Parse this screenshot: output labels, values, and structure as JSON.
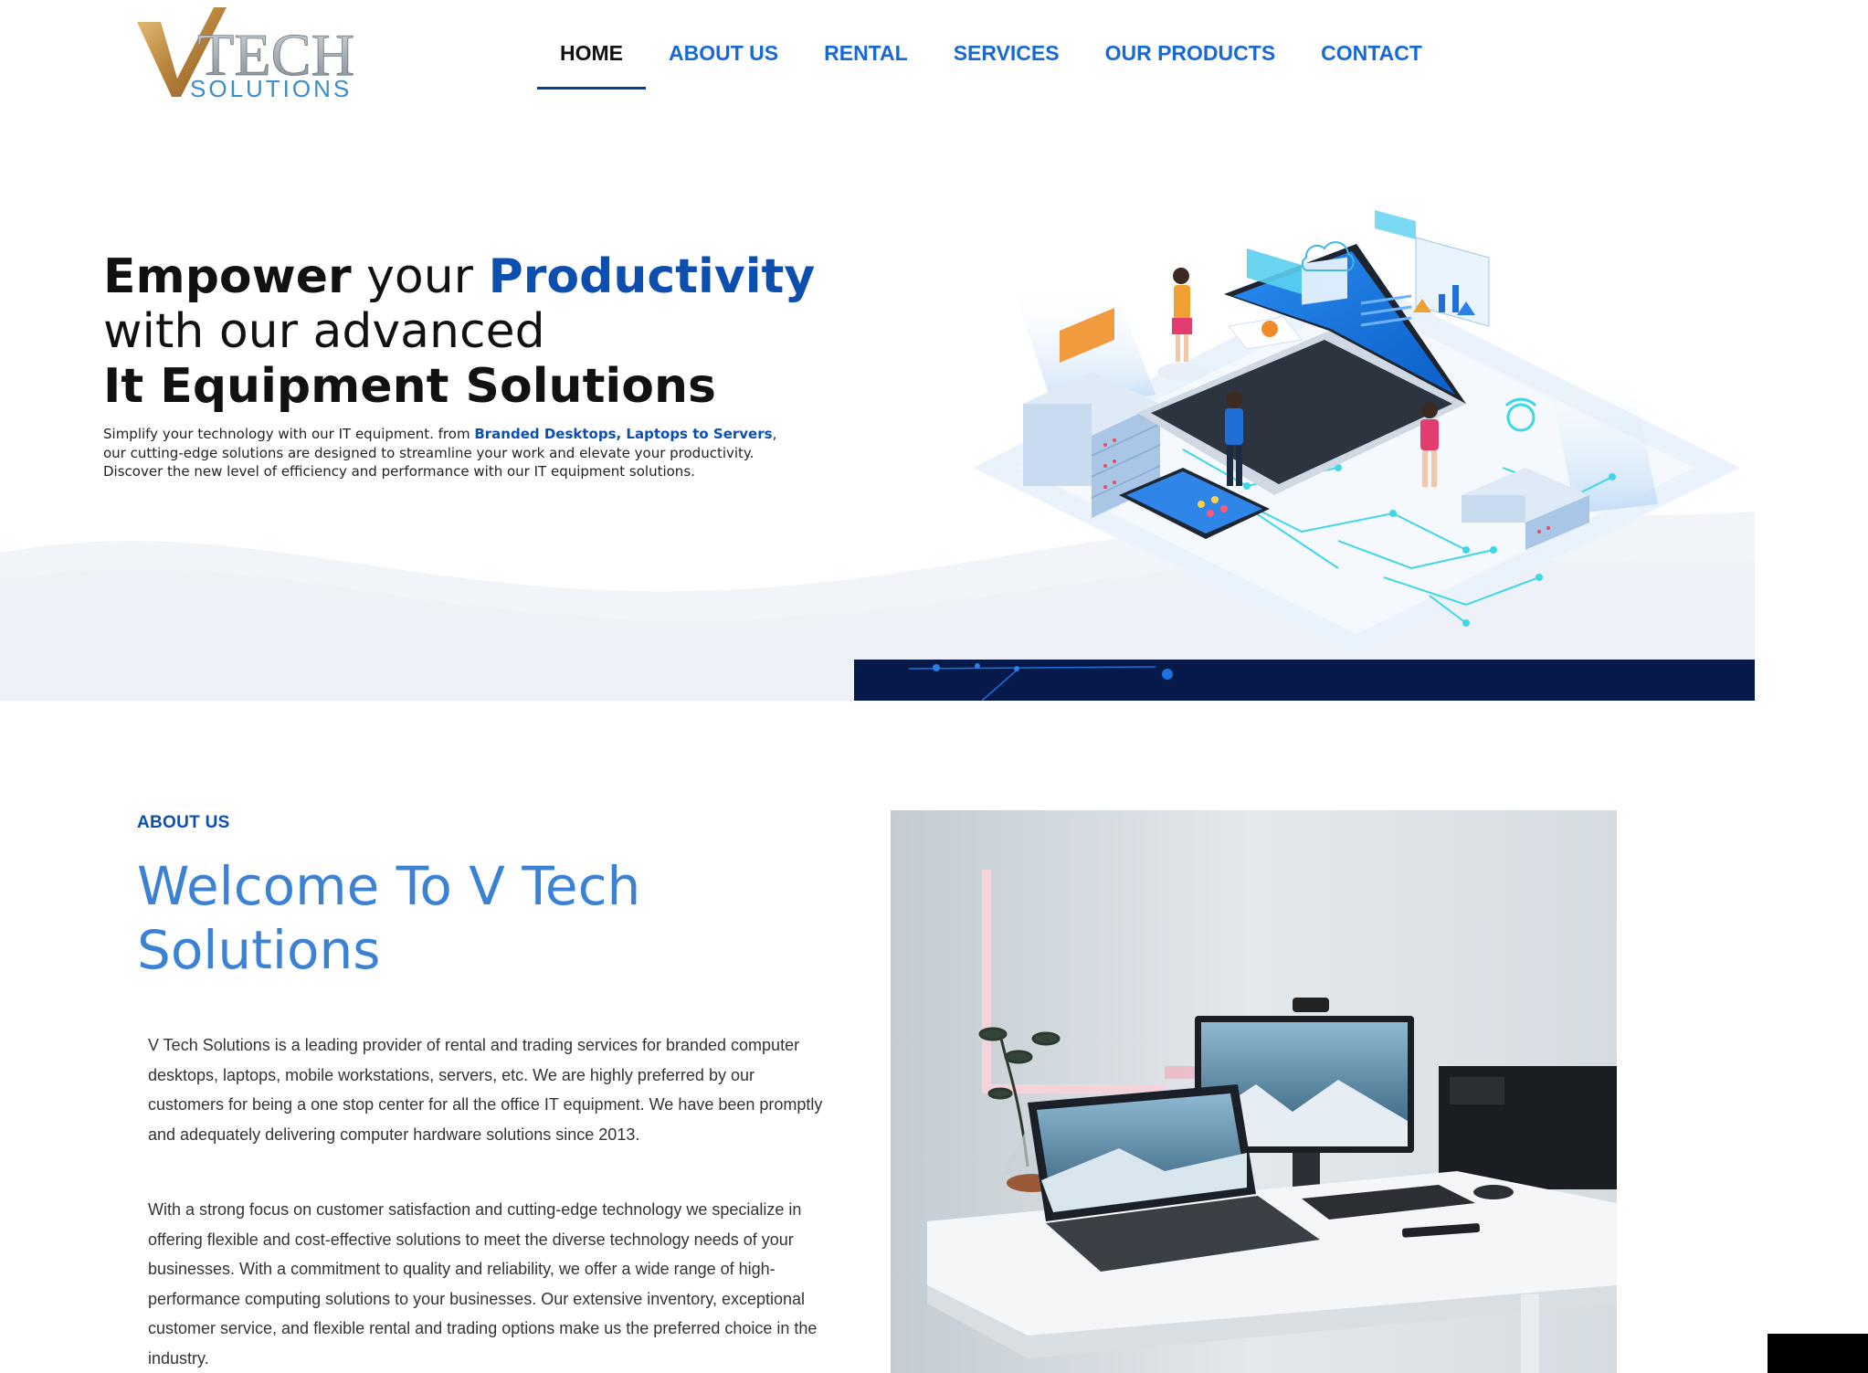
{
  "brand": {
    "logo_letters": "V TECH SOLUTIONS",
    "accent": "#0d4fae",
    "nav_color": "#1769d6"
  },
  "nav": {
    "items": [
      {
        "label": "HOME",
        "active": true
      },
      {
        "label": "ABOUT US",
        "active": false
      },
      {
        "label": "RENTAL",
        "active": false
      },
      {
        "label": "SERVICES",
        "active": false
      },
      {
        "label": "OUR PRODUCTS",
        "active": false
      },
      {
        "label": "CONTACT",
        "active": false
      }
    ]
  },
  "hero": {
    "title_empower": "Empower",
    "title_your": "your",
    "title_productivity": "Productivity",
    "title_line2": "with our advanced",
    "title_line3": "It Equipment Solutions",
    "desc_pre": "Simplify your technology with our IT equipment. from ",
    "desc_highlight": "Branded Desktops, Laptops to Servers",
    "desc_post": ", our cutting-edge solutions are designed to streamline your work and elevate your productivity.",
    "desc_line2": "Discover the new level of efficiency and performance with our IT equipment solutions.",
    "illustration_icon": "isometric-it-equipment-illustration"
  },
  "about": {
    "kicker": "ABOUT US",
    "title": "Welcome To V Tech Solutions",
    "p1": "V Tech Solutions is a leading provider of rental and trading services for branded computer desktops, laptops, mobile workstations, servers, etc. We are highly preferred by our customers for being a one stop center for all the office IT equipment. We have been promptly and adequately delivering computer hardware solutions since 2013.",
    "p2": "With a strong focus on customer satisfaction and cutting-edge technology we specialize in offering flexible and cost-effective solutions to meet the diverse technology needs of your businesses. With a commitment to quality and reliability, we offer a wide range of high-performance computing solutions to your businesses. Our extensive inventory, exceptional customer service, and flexible rental and trading options make us the preferred choice in the industry.",
    "photo_icon": "desk-workstation-photo"
  }
}
